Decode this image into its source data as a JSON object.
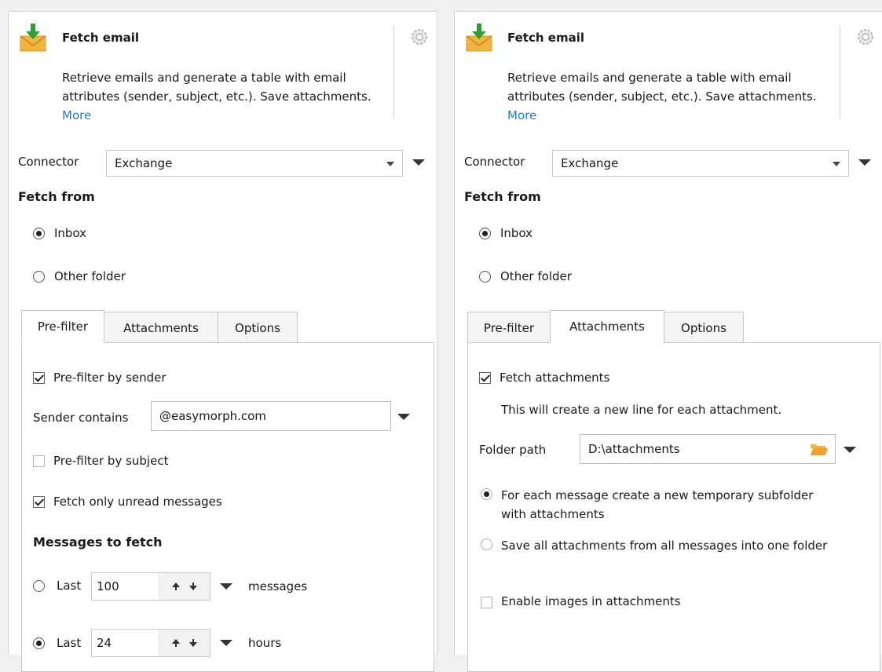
{
  "left": {
    "title": "Fetch email",
    "description": "Retrieve emails and generate a table with email attributes (sender, subject, etc.). Save attachments.",
    "more_link": "More",
    "connector_label": "Connector",
    "connector_value": "Exchange",
    "fetch_from_label": "Fetch from",
    "radio_inbox": "Inbox",
    "radio_other": "Other folder",
    "tabs": [
      "Pre-filter",
      "Attachments",
      "Options"
    ],
    "active_tab": "Pre-filter",
    "prefilter": {
      "by_sender_label": "Pre-filter by sender",
      "sender_contains_label": "Sender contains",
      "sender_value": "@easymorph.com",
      "by_subject_label": "Pre-filter by subject",
      "unread_label": "Fetch only unread messages",
      "messages_heading": "Messages to fetch",
      "last_label": "Last",
      "messages_count": "100",
      "messages_unit": "messages",
      "hours_count": "24",
      "hours_unit": "hours"
    }
  },
  "right": {
    "title": "Fetch email",
    "description": "Retrieve emails and generate a table with email attributes (sender, subject, etc.). Save attachments.",
    "more_link": "More",
    "connector_label": "Connector",
    "connector_value": "Exchange",
    "fetch_from_label": "Fetch from",
    "radio_inbox": "Inbox",
    "radio_other": "Other folder",
    "tabs": [
      "Pre-filter",
      "Attachments",
      "Options"
    ],
    "active_tab": "Attachments",
    "attachments": {
      "fetch_label": "Fetch attachments",
      "note": "This will create a new line for each attachment.",
      "folder_path_label": "Folder path",
      "folder_path_value": "D:\\attachments",
      "option_subfolder": "For each message create a new temporary subfolder with attachments",
      "option_one_folder": "Save all attachments from all messages into one folder",
      "enable_images_label": "Enable images in attachments"
    }
  },
  "icons": {
    "email": "email-download-icon",
    "settings": "gear-icon",
    "folder": "folder-icon"
  },
  "colors": {
    "link": "#1e7bd8",
    "envelope": "#f2b441",
    "download_arrow": "#2e9e36",
    "folder": "#f0a22e"
  }
}
